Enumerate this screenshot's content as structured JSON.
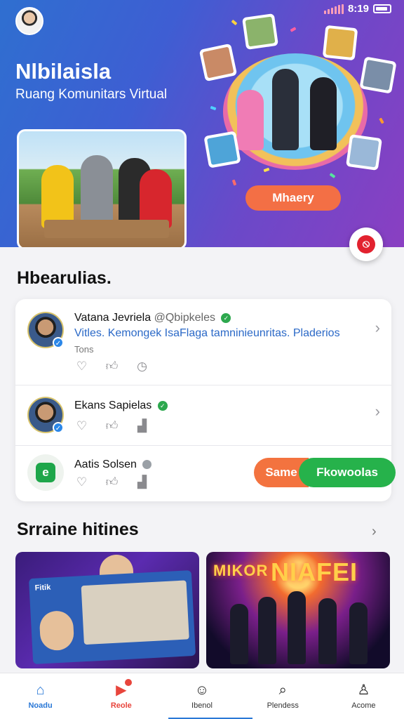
{
  "status_bar": {
    "time": "8:19"
  },
  "header": {
    "title": "Nlbilaisla",
    "subtitle": "Ruang Komunitars Virtual",
    "cta": "Mhaery"
  },
  "section1": {
    "title": "Hbearulias.",
    "rows": [
      {
        "name": "Vatana Jevriela",
        "handle": "Qbipkeles",
        "message": "Vitles. Kemongek IsaFlaga tamninieunritas. Pladerios",
        "sub": "Tons"
      },
      {
        "name": "Ekans Sapielas"
      },
      {
        "name": "Aatis Solsen",
        "toggle": {
          "left": "Same",
          "right": "Fkowoolas"
        }
      }
    ]
  },
  "section2": {
    "title": "Srraine hitines"
  },
  "media": {
    "card1_label": "Fitik",
    "card2_sign": "NIAFEI",
    "card2_sign2": "MIKOR"
  },
  "nav": {
    "items": [
      {
        "label": "Noadu",
        "icon": "home-icon"
      },
      {
        "label": "Reole",
        "icon": "play-icon"
      },
      {
        "label": "Ibenol",
        "icon": "face-icon"
      },
      {
        "label": "Plendess",
        "icon": "search-icon"
      },
      {
        "label": "Acome",
        "icon": "user-icon"
      }
    ]
  },
  "colors": {
    "accent_orange": "#f36f45",
    "accent_green": "#26b24b",
    "nav_active": "#2a78d6"
  }
}
